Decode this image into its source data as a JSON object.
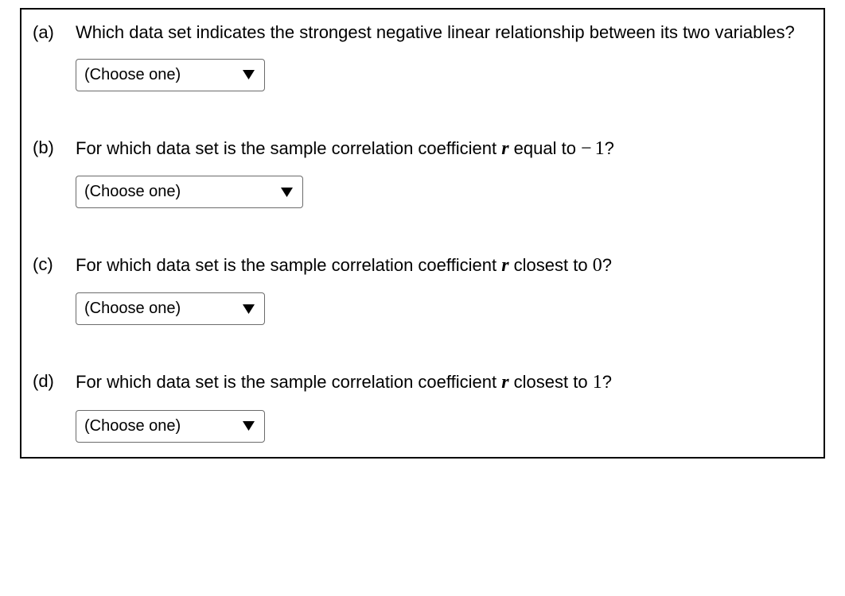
{
  "questions": {
    "a": {
      "label": "(a)",
      "text": "Which data set indicates the strongest negative linear relationship between its two variables?",
      "dropdown_placeholder": "(Choose one)"
    },
    "b": {
      "label": "(b)",
      "text_before_r": "For which data set is the sample correlation coefficient ",
      "r_symbol": "r",
      "text_after_r": " equal to ",
      "minus": "−",
      "value": "1",
      "q_mark": "?",
      "dropdown_placeholder": "(Choose one)"
    },
    "c": {
      "label": "(c)",
      "text_before_r": "For which data set is the sample correlation coefficient ",
      "r_symbol": "r",
      "text_after_r": " closest to ",
      "value": "0",
      "q_mark": "?",
      "dropdown_placeholder": "(Choose one)"
    },
    "d": {
      "label": "(d)",
      "text_before_r": "For which data set is the sample correlation coefficient ",
      "r_symbol": "r",
      "text_after_r": " closest to ",
      "value": "1",
      "q_mark": "?",
      "dropdown_placeholder": "(Choose one)"
    }
  }
}
